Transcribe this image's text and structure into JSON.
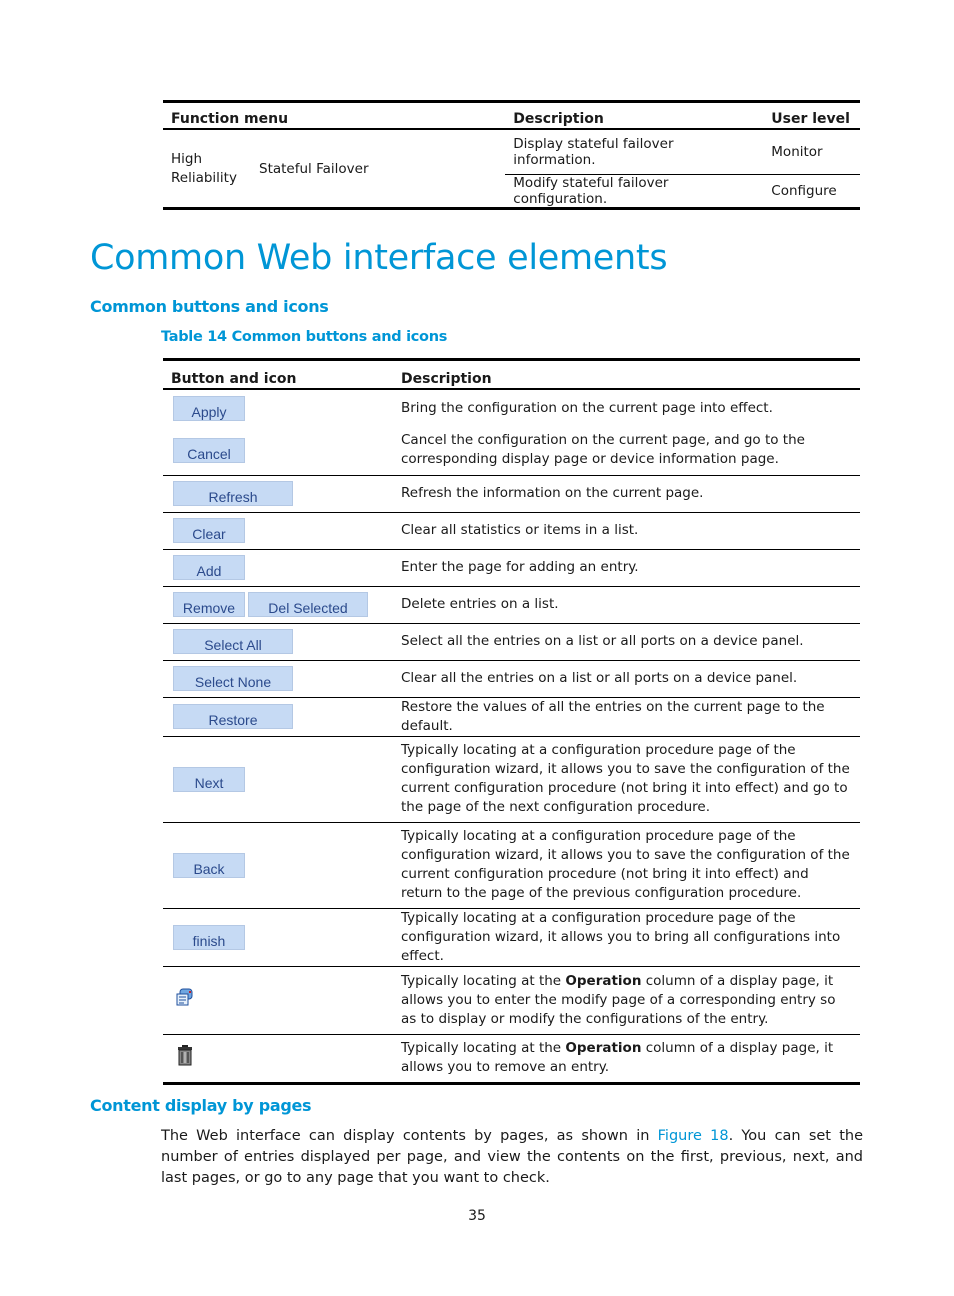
{
  "top_table": {
    "headers": [
      "Function menu",
      "Description",
      "User level"
    ],
    "group": "High Reliability",
    "function": "Stateful Failover",
    "rows": [
      {
        "description": "Display stateful failover information.",
        "user_level": "Monitor"
      },
      {
        "description": "Modify stateful failover configuration.",
        "user_level": "Configure"
      }
    ]
  },
  "section_title": "Common Web interface elements",
  "subsection1_title": "Common buttons and icons",
  "table_caption": "Table 14 Common buttons and icons",
  "buttons_table": {
    "headers": [
      "Button and icon",
      "Description"
    ],
    "rows": [
      {
        "buttons": [
          "Apply"
        ],
        "description": "Bring the configuration on the current page into effect."
      },
      {
        "buttons": [
          "Cancel"
        ],
        "description": "Cancel the configuration on the current page, and go to the corresponding display page or device information page."
      },
      {
        "buttons": [
          "Refresh"
        ],
        "description": "Refresh the information on the current page."
      },
      {
        "buttons": [
          "Clear"
        ],
        "description": "Clear all statistics or items in a list."
      },
      {
        "buttons": [
          "Add"
        ],
        "description": "Enter the page for adding an entry."
      },
      {
        "buttons": [
          "Remove",
          "Del Selected"
        ],
        "description": "Delete entries on a list."
      },
      {
        "buttons": [
          "Select All"
        ],
        "description": "Select all the entries on a list or all ports on a device panel."
      },
      {
        "buttons": [
          "Select None"
        ],
        "description": "Clear all the entries on a list or all ports on a device panel."
      },
      {
        "buttons": [
          "Restore"
        ],
        "description": "Restore the values of all the entries on the current page to the default."
      },
      {
        "buttons": [
          "Next"
        ],
        "description": "Typically locating at a configuration procedure page of the configuration wizard, it allows you to save the configuration of the current configuration procedure (not bring it into effect) and go to the page of the next configuration procedure."
      },
      {
        "buttons": [
          "Back"
        ],
        "description": "Typically locating at a configuration procedure page of the configuration wizard, it allows you to save the configuration of the current configuration procedure (not bring it into effect) and return to the page of the previous configuration procedure."
      },
      {
        "buttons": [
          "finish"
        ],
        "description": "Typically locating at a configuration procedure page of the configuration wizard, it allows you to bring all configurations into effect."
      },
      {
        "icon": "modify-icon",
        "description_pre": "Typically locating at the ",
        "description_bold": "Operation",
        "description_post": " column of a display page, it allows you to enter the modify page of a corresponding entry so as to display or modify the configurations of the entry."
      },
      {
        "icon": "trash-icon",
        "description_pre": "Typically locating at the ",
        "description_bold": "Operation",
        "description_post": " column of a display page, it allows you to remove an entry."
      }
    ]
  },
  "subsection2_title": "Content display by pages",
  "paragraph": {
    "pre": "The Web interface can display contents by pages, as shown in ",
    "link": "Figure 18",
    "post": ". You can set the number of entries displayed per page, and view the contents on the first, previous, next, and last pages, or go to any page that you want to check."
  },
  "page_number": "35",
  "colors": {
    "accent": "#0096d6",
    "button_bg": "#c6daf4",
    "button_text": "#2b4a8c"
  }
}
